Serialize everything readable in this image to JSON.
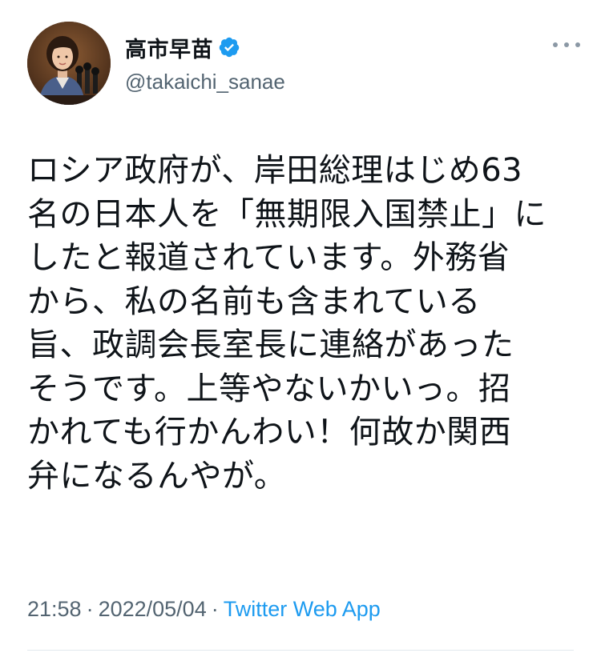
{
  "author": {
    "display_name": "高市早苗",
    "handle": "@takaichi_sanae",
    "verified": true,
    "avatar_icon": "profile-photo"
  },
  "more_icon": "ellipsis-icon",
  "tweet": {
    "text": "ロシア政府が、岸田総理はじめ63\n名の日本人を「無期限入国禁止」に\nしたと報道されています。外務省\nから、私の名前も含まれている\n旨、政調会長室長に連絡があった\nそうです。上等やないかいっ。招\nかれても行かんわい！何故か関西\n弁になるんやが。",
    "time": "21:58",
    "date": "2022/05/04",
    "separator": "·",
    "source": "Twitter Web App"
  },
  "colors": {
    "text": "#0f1419",
    "secondary": "#536471",
    "accent": "#1d9bf0"
  }
}
